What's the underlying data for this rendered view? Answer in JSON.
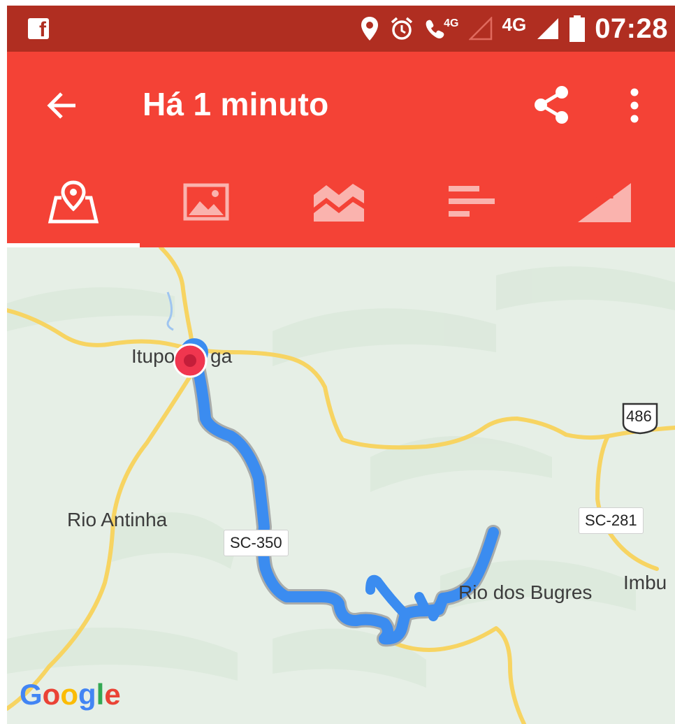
{
  "status_bar": {
    "network_4g_call": "4G",
    "network_4g": "4G",
    "time": "07:28"
  },
  "app_bar": {
    "title": "Há 1 minuto"
  },
  "tabs": [
    {
      "icon": "map-icon",
      "selected": true
    },
    {
      "icon": "image-icon",
      "selected": false
    },
    {
      "icon": "chart-icon",
      "selected": false
    },
    {
      "icon": "bars-icon",
      "selected": false
    },
    {
      "icon": "elevation-icon",
      "selected": false
    }
  ],
  "map": {
    "places": [
      "Itupo",
      "ga",
      "Rio Antinha",
      "Rio dos Bugres",
      "Imbu"
    ],
    "roads": [
      "SC-350",
      "SC-281",
      "486"
    ],
    "attribution": {
      "G": "G",
      "o1": "o",
      "o2": "o",
      "g": "g",
      "l": "l",
      "e": "e"
    }
  },
  "colors": {
    "status_bar": "#b02e21",
    "app_bar": "#f44236",
    "route": "#3b8cf0",
    "marker": "#f0364f",
    "map_bg": "#e6efe6",
    "road": "#f7d462"
  }
}
